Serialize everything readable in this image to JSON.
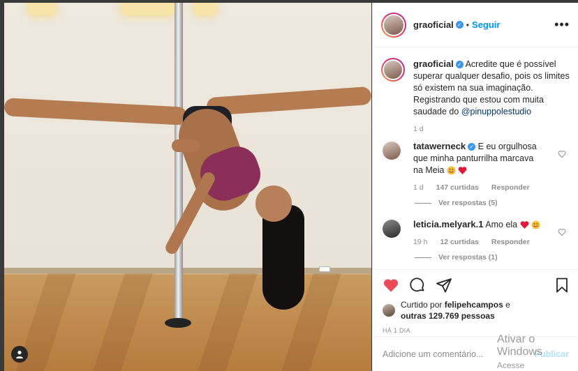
{
  "post": {
    "username": "graoficial",
    "follow_label": "Seguir",
    "separator": "•",
    "more_label": "•••",
    "verified_mark": "✓"
  },
  "caption": {
    "username": "graoficial",
    "text": "Acredite que é possível superar qualquer desafio, pois os limites só existem na sua imaginação. Registrando que estou com muita saudade do",
    "mention": "@pinuppolestudio",
    "time": "1 d"
  },
  "comments": [
    {
      "username": "tatawerneck",
      "verified": true,
      "text": "E eu orgulhosa que minha panturrilha marcava na Meia",
      "emojis": [
        "smile-emoji",
        "heart-emoji"
      ],
      "time": "1 d",
      "likes": "147 curtidas",
      "reply_label": "Responder",
      "view_replies": "Ver respostas (5)"
    },
    {
      "username": "leticia.melyark.1",
      "verified": false,
      "text": "Amo ela",
      "emojis": [
        "heart-emoji",
        "smile-emoji"
      ],
      "time": "19 h",
      "likes": "12 curtidas",
      "reply_label": "Responder",
      "view_replies": "Ver respostas (1)"
    }
  ],
  "actions": {
    "liked_by_prefix": "Curtido por",
    "liked_by_user": "felipehcampos",
    "liked_by_suffix": "e",
    "others": "outras 129.769 pessoas",
    "time_ago": "HÁ 1 DIA"
  },
  "add_comment": {
    "placeholder": "Adicione um comentário...",
    "publish_label": "Publicar"
  },
  "watermark": {
    "line1": "Ativar o Windows",
    "line2": "Acesse Configurações"
  },
  "colors": {
    "like_red": "#ed4956",
    "link_blue": "#0095f6",
    "verified_blue": "#3897f0",
    "muted": "#8e8e8e"
  }
}
